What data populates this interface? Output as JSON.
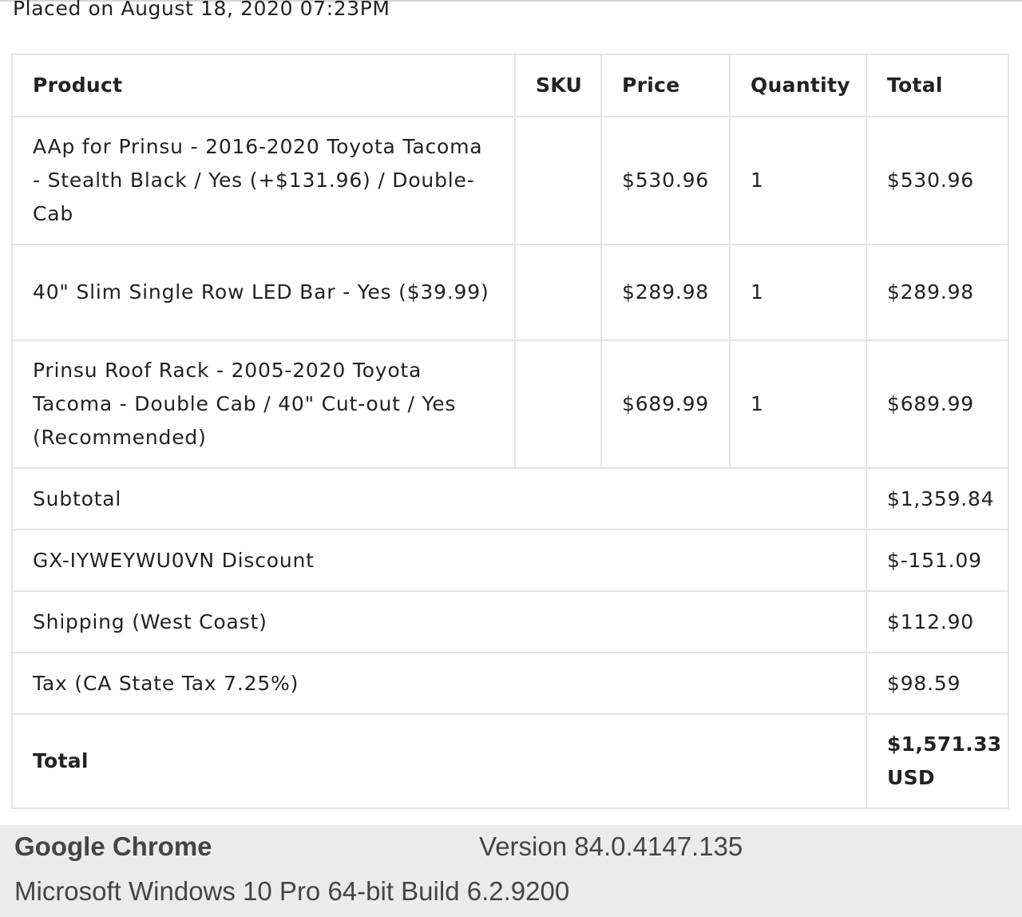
{
  "order": {
    "placed_text": "Placed on August 18, 2020 07:23PM",
    "columns": {
      "product": "Product",
      "sku": "SKU",
      "price": "Price",
      "quantity": "Quantity",
      "total": "Total"
    },
    "items": [
      {
        "product": "AAp for Prinsu - 2016-2020 Toyota Tacoma - Stealth Black / Yes (+$131.96) / Double-Cab",
        "sku": "",
        "price": "$530.96",
        "quantity": "1",
        "total": "$530.96"
      },
      {
        "product": "40\" Slim Single Row LED Bar - Yes ($39.99)",
        "sku": "",
        "price": "$289.98",
        "quantity": "1",
        "total": "$289.98"
      },
      {
        "product": "Prinsu Roof Rack - 2005-2020 Toyota Tacoma - Double Cab / 40\" Cut-out / Yes (Recommended)",
        "sku": "",
        "price": "$689.99",
        "quantity": "1",
        "total": "$689.99"
      }
    ],
    "summary": [
      {
        "label": "Subtotal",
        "value": "$1,359.84"
      },
      {
        "label": "GX-IYWEYWU0VN Discount",
        "value": "$-151.09"
      },
      {
        "label": "Shipping (West Coast)",
        "value": "$112.90"
      },
      {
        "label": "Tax (CA State Tax 7.25%)",
        "value": "$98.59"
      }
    ],
    "grand_total": {
      "label": "Total",
      "value": "$1,571.33 USD"
    }
  },
  "footer": {
    "browser_name": "Google Chrome",
    "browser_version": "Version 84.0.4147.135",
    "os_info": "Microsoft Windows 10 Pro 64-bit Build 6.2.9200"
  }
}
